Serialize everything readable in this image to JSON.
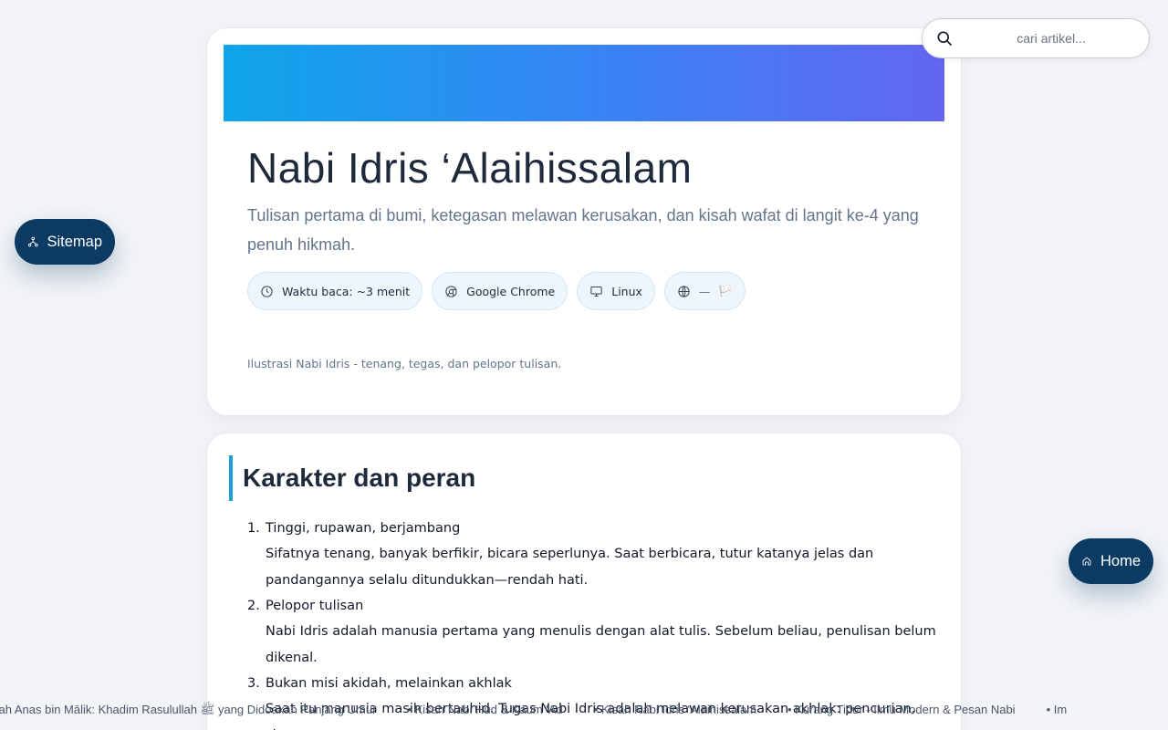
{
  "hero": {
    "title": "Nabi Idris ‘Alaihissalam",
    "subtitle": "Tulisan pertama di bumi, ketegasan melawan kerusakan, dan kisah wafat di langit ke-4 yang penuh hikmah.",
    "chips": {
      "reading_time": "Waktu baca: ~3 menit",
      "browser": "Google Chrome",
      "os": "Linux",
      "language_value": "—",
      "flag": "🏳️"
    },
    "image_caption": "Ilustrasi Nabi Idris - tenang, tegas, dan pelopor tulisan.",
    "banner_colors": [
      "#0ea5e9",
      "#3b82f6",
      "#6366f1"
    ]
  },
  "section": {
    "title": "Karakter dan peran",
    "items": [
      {
        "number": "1.",
        "head": "Tinggi, rupawan, berjambang",
        "desc": "Sifatnya tenang, banyak berfikir, bicara seperlunya. Saat berbicara, tutur katanya jelas dan pandangannya selalu ditundukkan—rendah hati."
      },
      {
        "number": "2.",
        "head": "Pelopor tulisan",
        "desc": "Nabi Idris adalah manusia pertama yang menulis dengan alat tulis. Sebelum beliau, penulisan belum dikenal."
      },
      {
        "number": "3.",
        "head": "Bukan misi akidah, melainkan akhlak",
        "desc": "Saat itu manusia masih bertauhid. Tugas Nabi Idris adalah melawan kerusakan akhlak: pencurian, zina,"
      }
    ]
  },
  "search": {
    "placeholder": "cari artikel..."
  },
  "buttons": {
    "sitemap": "Sitemap",
    "home": "Home"
  },
  "ticker": {
    "items": [
      "sah Anas bin Mālik: Khadim Rasulullah ﷺ yang Didoakan Panjang Umur",
      "Kisah Nabi Hud & Kaum 'Ad",
      "Kisah Nabi Idris 'Alaihissalam",
      "Kurang Tidur - Ilmu Modern & Pesan Nabi",
      "Im"
    ]
  },
  "colors": {
    "accent": "#1aa0d8",
    "button_bg": "#0b3a63",
    "page_bg": "#f2f4f7"
  }
}
